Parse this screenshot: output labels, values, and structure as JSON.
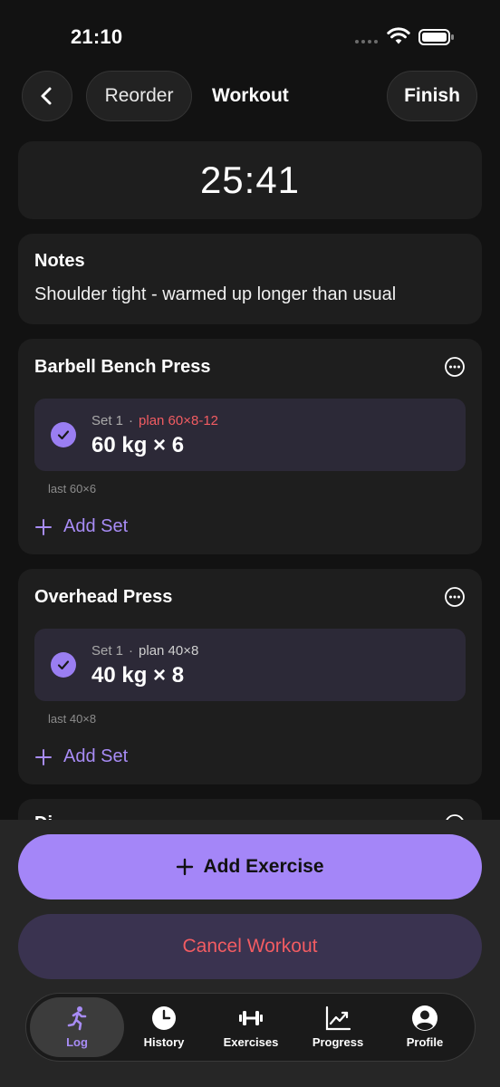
{
  "status": {
    "time": "21:10"
  },
  "header": {
    "reorder_label": "Reorder",
    "title": "Workout",
    "finish_label": "Finish"
  },
  "timer": "25:41",
  "notes": {
    "label": "Notes",
    "text": "Shoulder tight - warmed up longer than usual"
  },
  "exercises": [
    {
      "name": "Barbell Bench Press",
      "set_label": "Set 1",
      "separator": "·",
      "plan": "plan 60×8-12",
      "value": "60 kg × 6",
      "last": "last 60×6",
      "add_set": "Add Set"
    },
    {
      "name": "Overhead Press",
      "set_label": "Set 1",
      "separator": "·",
      "plan": "plan 40×8",
      "value": "40 kg × 8",
      "last": "last 40×8",
      "add_set": "Add Set"
    },
    {
      "name": "Di"
    }
  ],
  "actions": {
    "add_exercise": "Add Exercise",
    "cancel_workout": "Cancel Workout"
  },
  "tabs": [
    {
      "label": "Log",
      "icon": "run-icon",
      "active": true
    },
    {
      "label": "History",
      "icon": "clock-icon",
      "active": false
    },
    {
      "label": "Exercises",
      "icon": "dumbbell-icon",
      "active": false
    },
    {
      "label": "Progress",
      "icon": "chart-icon",
      "active": false
    },
    {
      "label": "Profile",
      "icon": "profile-icon",
      "active": false
    }
  ],
  "colors": {
    "accent": "#a486f8",
    "danger": "#f25c62",
    "background": "#121212",
    "card": "#1e1e1e"
  }
}
